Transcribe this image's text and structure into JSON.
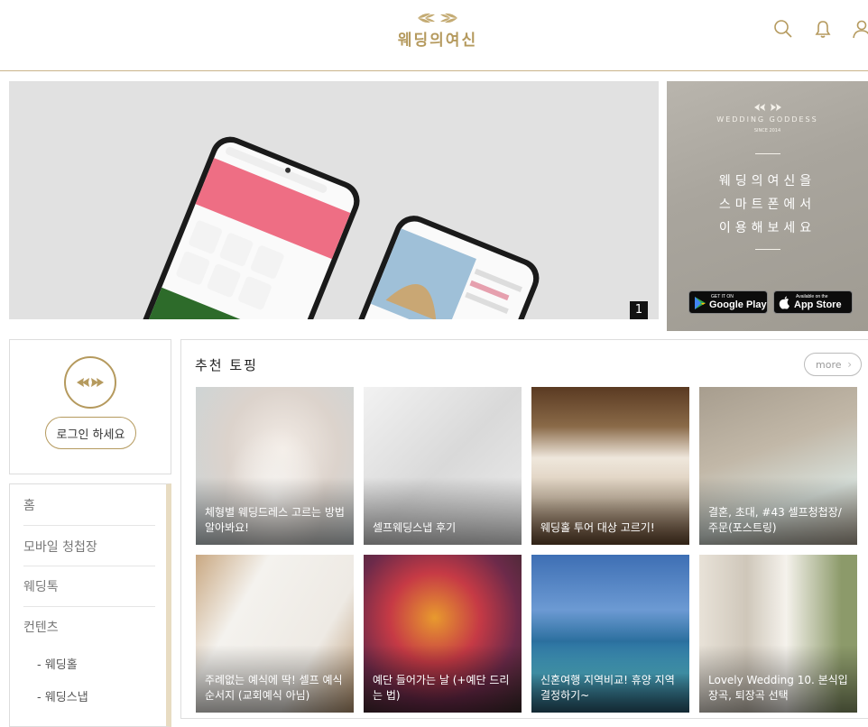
{
  "header": {
    "logo_text": "웨딩의여신",
    "icons": [
      "search-icon",
      "bell-icon",
      "user-icon"
    ],
    "accent_color": "#b59a5e"
  },
  "banner": {
    "slide_counter": "1"
  },
  "side_banner": {
    "brand": "WEDDING GODDESS",
    "sub": "SINCE 2014",
    "lines": [
      "웨딩의여신을",
      "스마트폰에서",
      "이용해보세요"
    ],
    "google_play": {
      "small": "GET IT ON",
      "big": "Google Play"
    },
    "app_store": {
      "small": "Available on the",
      "big": "App Store"
    }
  },
  "login": {
    "button_label": "로그인 하세요"
  },
  "nav": {
    "items": [
      "홈",
      "모바일 청첩장",
      "웨딩톡",
      "컨텐츠"
    ],
    "subitems": [
      "- 웨딩홀",
      "- 웨딩스냅"
    ]
  },
  "topics": {
    "title": "추천 토핑",
    "more_label": "more",
    "cards": [
      {
        "caption": "체형별 웨딩드레스 고르는 방법 알아봐요!"
      },
      {
        "caption": "셀프웨딩스냅 후기"
      },
      {
        "caption": "웨딩홀 투어 대상 고르기!"
      },
      {
        "caption": "결혼, 초대, #43 셀프청첩장/ 주문(포스트링)"
      },
      {
        "caption": "주례없는 예식에 딱! 셀프 예식 순서지 (교회예식 아님)"
      },
      {
        "caption": "예단 들어가는 날 (+예단 드리는 법)"
      },
      {
        "caption": "신혼여행 지역비교! 휴양 지역결정하기~"
      },
      {
        "caption": "Lovely Wedding 10. 본식입장곡, 퇴장곡 선택"
      }
    ]
  }
}
